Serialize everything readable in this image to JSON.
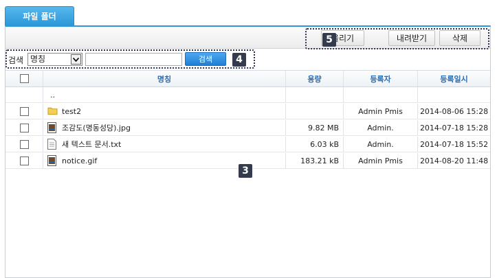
{
  "tab": {
    "label": "파일 폴더"
  },
  "toolbar": {
    "upload_label": "올리기",
    "download_label": "내려받기",
    "delete_label": "삭제",
    "callout_5": "5"
  },
  "search": {
    "label": "검색",
    "field_selected": "명칭",
    "input_value": "",
    "button_label": "검색",
    "callout_4": "4"
  },
  "table": {
    "columns": {
      "name": "명칭",
      "size": "용량",
      "registrant": "등록자",
      "date": "등록일시"
    },
    "rows": [
      {
        "icon": "parent-folder",
        "name": "..",
        "size": "",
        "registrant": "",
        "date": ""
      },
      {
        "icon": "folder-icon",
        "name": "test2",
        "size": "",
        "registrant": "Admin Pmis",
        "date": "2014-08-06 15:28"
      },
      {
        "icon": "image-file-icon",
        "name": "조감도(명동성당).jpg",
        "size": "9.82 MB",
        "registrant": "Admin.",
        "date": "2014-07-18 15:28"
      },
      {
        "icon": "text-file-icon",
        "name": "새 텍스트 문서.txt",
        "size": "6.03 kB",
        "registrant": "Admin.",
        "date": "2014-07-18 15:52"
      },
      {
        "icon": "image-file-icon",
        "name": "notice.gif",
        "size": "183.21 kB",
        "registrant": "Admin Pmis",
        "date": "2014-08-20 11:48"
      }
    ],
    "callout_3": "3"
  },
  "colors": {
    "accent": "#2d98d9",
    "header_text": "#2a6db0",
    "callout": "#333b4d"
  }
}
